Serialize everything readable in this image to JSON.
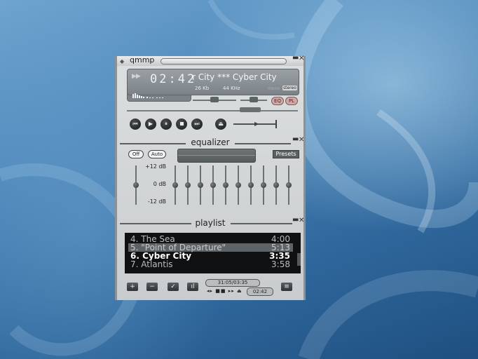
{
  "window": {
    "title": "qmmp"
  },
  "display": {
    "time": "02:42",
    "song_title": "r City   *** Cyber City",
    "bitrate": "26 Kb",
    "samplerate": "44 KHz",
    "mono": "mono",
    "stereo": "stereo",
    "eq_label": "EQ",
    "pl_label": "PL",
    "seek_position": 0.72,
    "volume": 0.5,
    "balance": 0.5
  },
  "controls": {
    "previous": "⏮",
    "play": "▶",
    "pause": "⏸",
    "stop": "⏹",
    "next": "⏭",
    "eject": "⏏"
  },
  "equalizer": {
    "title": "equalizer",
    "off_label": "Off",
    "auto_label": "Auto",
    "presets_label": "Presets",
    "db_high": "+12 dB",
    "db_mid": "0 dB",
    "db_low": "-12 dB",
    "preamp": 0,
    "bands": [
      0,
      0,
      0,
      0,
      0,
      0,
      0,
      0,
      0,
      0
    ]
  },
  "playlist": {
    "title": "playlist",
    "items": [
      {
        "title": "4. The Sea",
        "duration": "4:00",
        "state": "normal"
      },
      {
        "title": "5. \"Point of Departure\"",
        "duration": "5:13",
        "state": "selected"
      },
      {
        "title": "6. Cyber City",
        "duration": "3:35",
        "state": "current"
      },
      {
        "title": "7. Atlantis",
        "duration": "3:58",
        "state": "normal"
      }
    ],
    "position_text": "31:05/03:35",
    "elapsed_text": "02:42"
  },
  "icons": {
    "add": "+",
    "remove": "−",
    "select": "✓",
    "misc": "ıl",
    "menu": "≡"
  }
}
